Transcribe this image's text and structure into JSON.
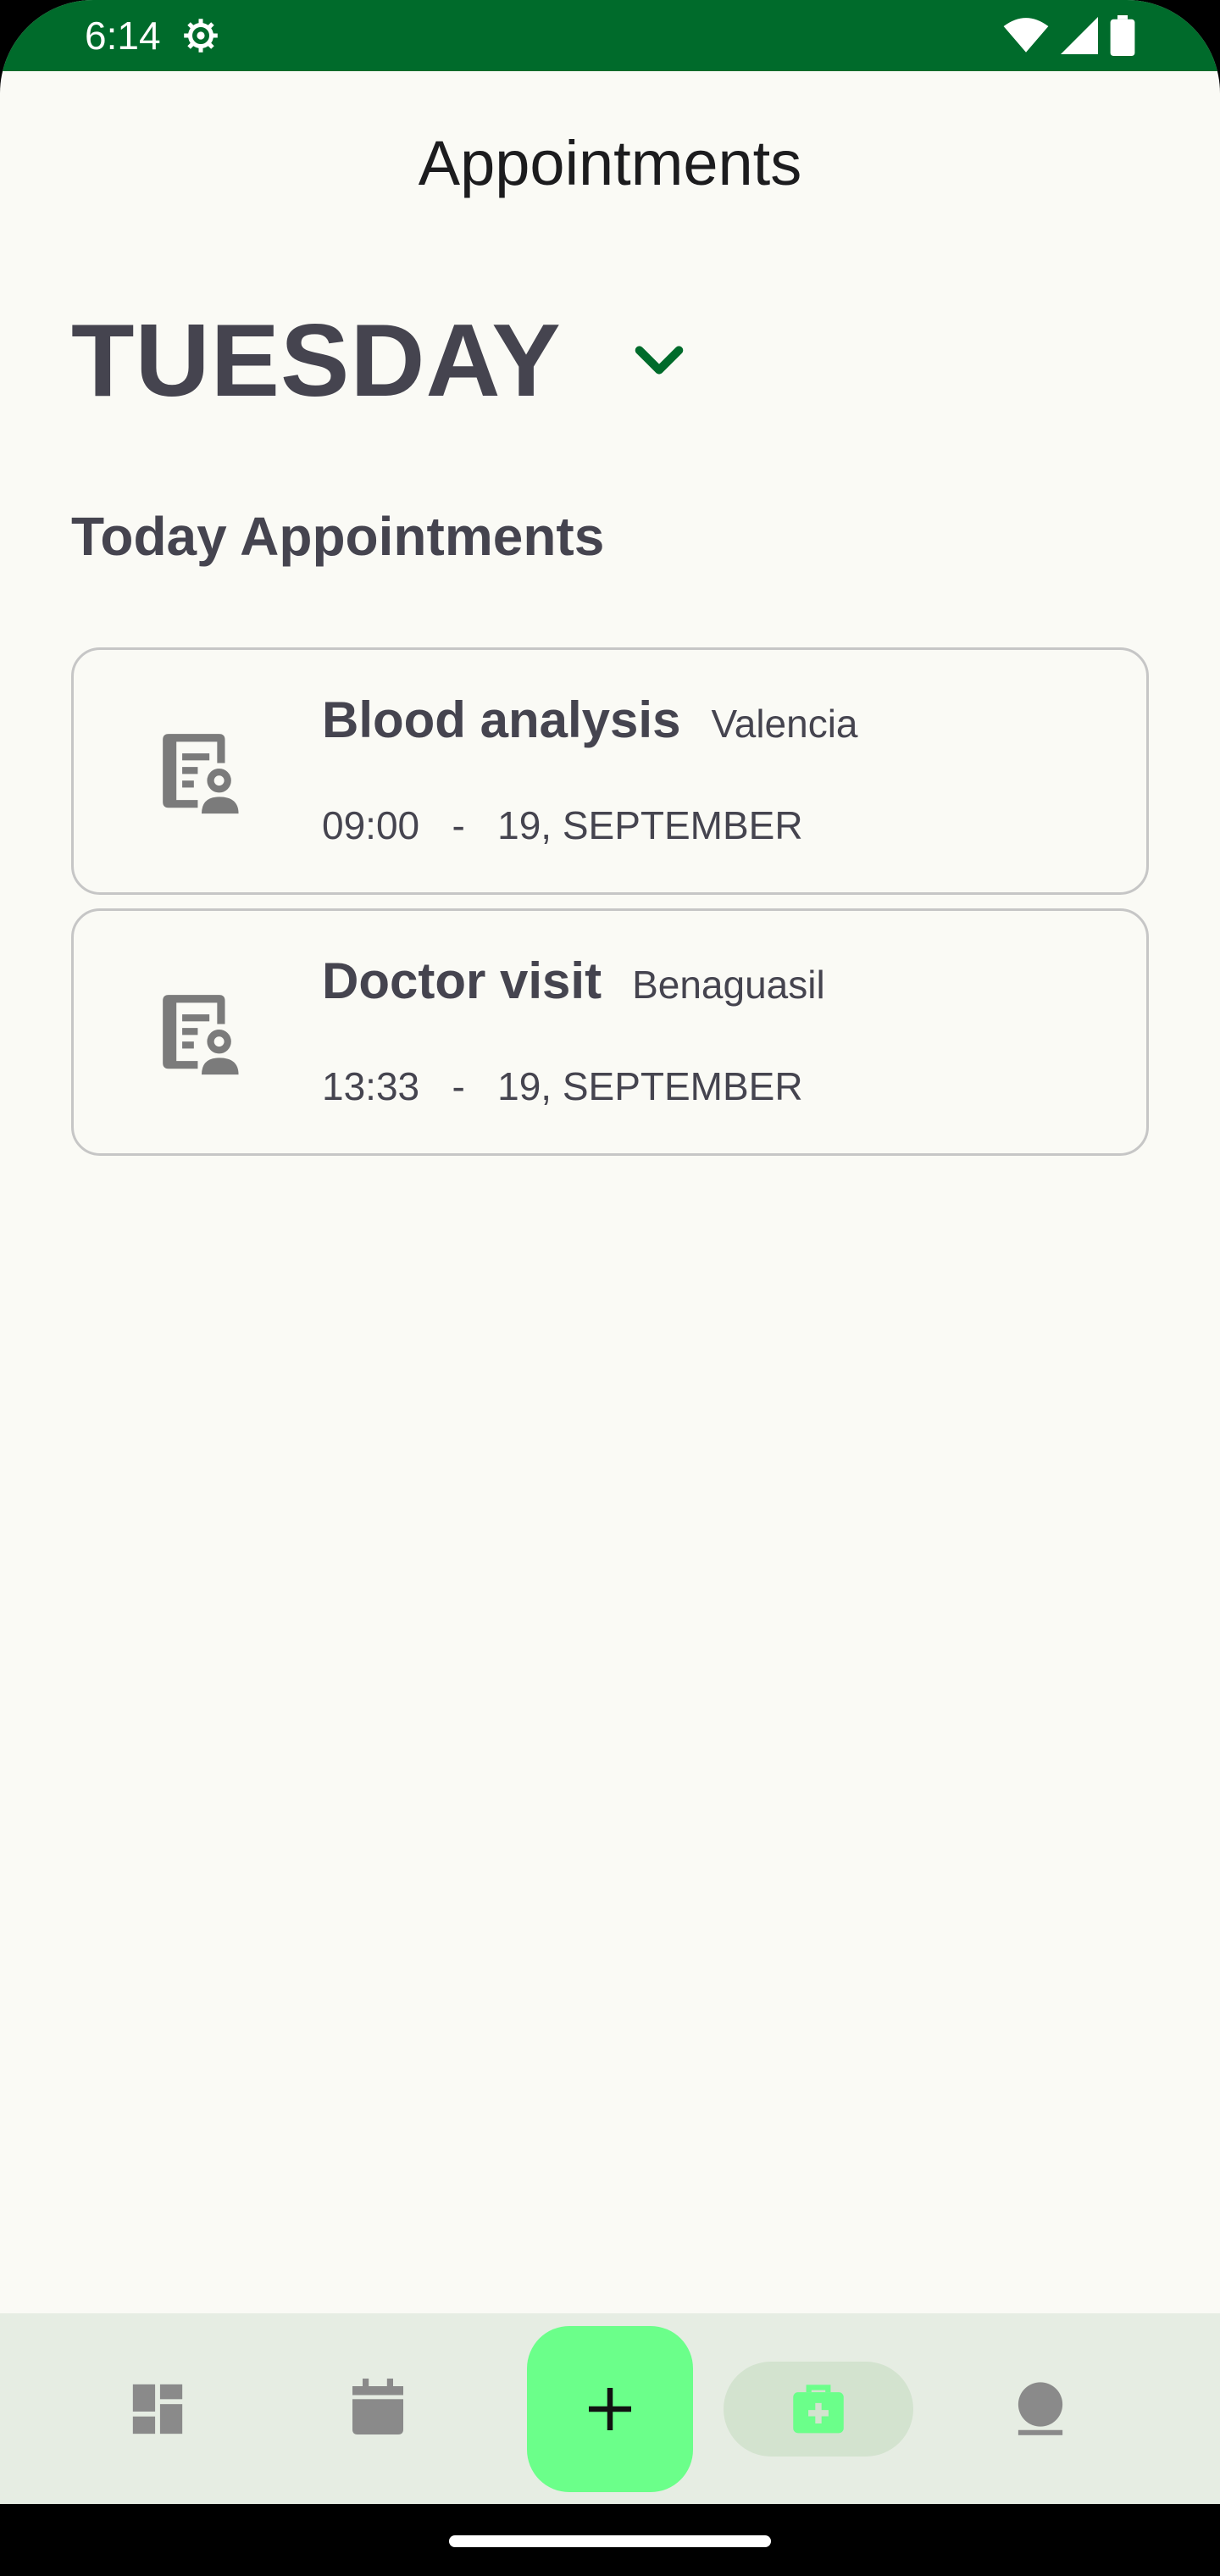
{
  "status_bar": {
    "time": "6:14"
  },
  "header": {
    "title": "Appointments"
  },
  "day_selector": {
    "day": "TUESDAY"
  },
  "section": {
    "title": "Today Appointments"
  },
  "appointments": [
    {
      "title": "Blood analysis",
      "location": "Valencia",
      "datetime": "09:00   -   19, SEPTEMBER",
      "icon": "document-image-icon"
    },
    {
      "title": "Doctor visit",
      "location": "Benaguasil",
      "datetime": "13:33   -   19, SEPTEMBER",
      "icon": "document-image-icon"
    }
  ],
  "bottom_nav": {
    "items": [
      "dashboard-icon",
      "calendar-icon",
      "add-icon",
      "medical-kit-icon",
      "profile-icon"
    ],
    "active": "medical-kit-icon"
  },
  "colors": {
    "status_bar": "#006b2b",
    "accent": "#6bff8a",
    "text": "#45444f",
    "background": "#fafaf5"
  }
}
